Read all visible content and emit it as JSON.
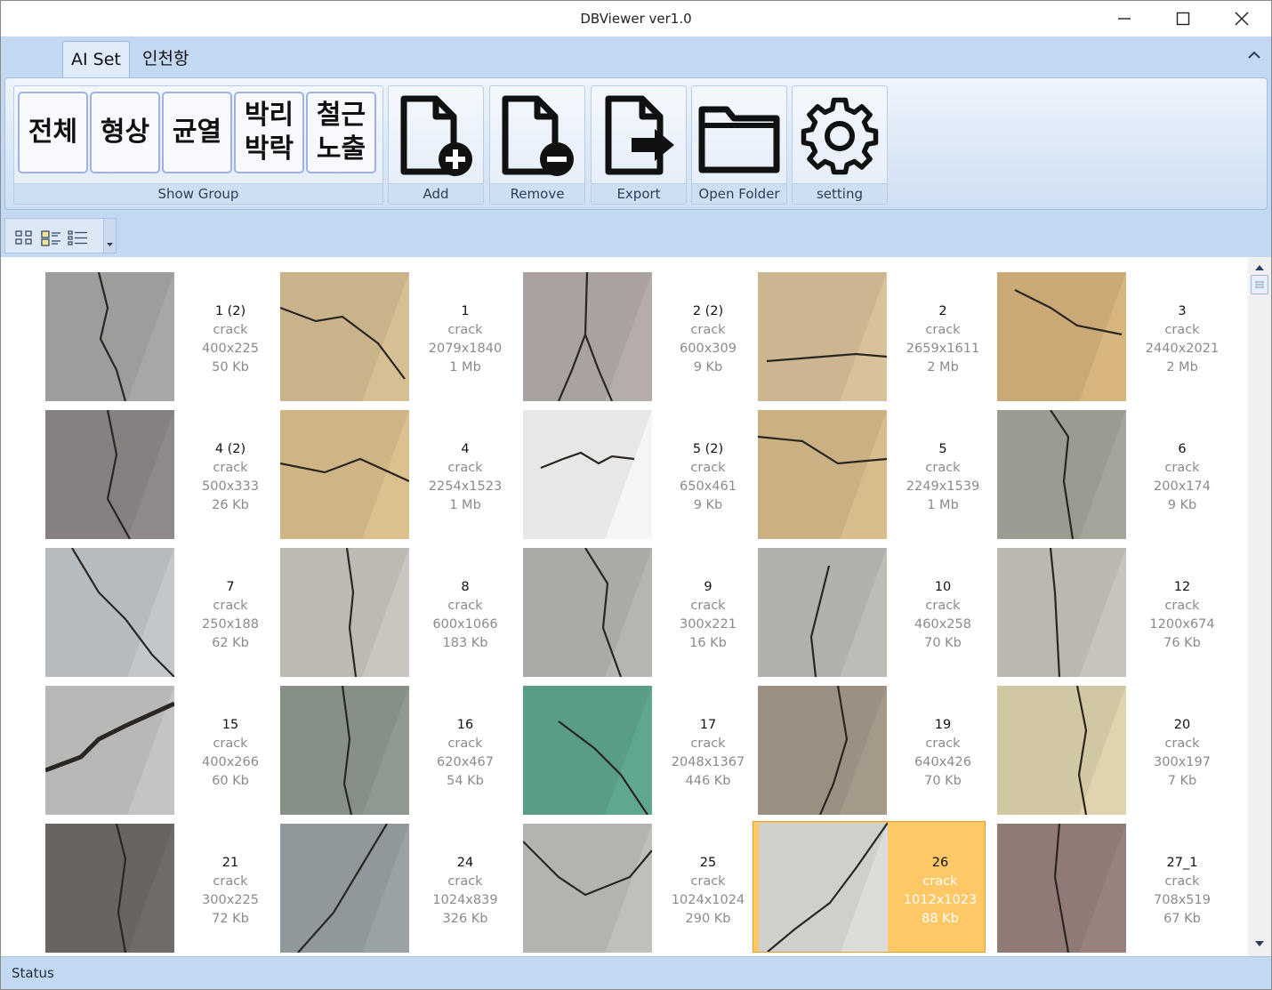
{
  "window": {
    "title": "DBViewer ver1.0"
  },
  "ribbon": {
    "tabs": [
      {
        "label": "AI Set",
        "active": true
      },
      {
        "label": "인천항",
        "active": false
      }
    ],
    "show_group": {
      "label": "Show Group",
      "buttons": [
        "전체",
        "형상",
        "균열",
        "박리\n박락",
        "철근\n노출"
      ]
    },
    "actions": [
      {
        "label": "Add",
        "icon": "add-file-icon"
      },
      {
        "label": "Remove",
        "icon": "remove-file-icon"
      },
      {
        "label": "Export",
        "icon": "export-file-icon"
      },
      {
        "label": "Open Folder",
        "icon": "folder-icon"
      },
      {
        "label": "setting",
        "icon": "gear-icon"
      }
    ]
  },
  "view_toolbar": {
    "icons": [
      "large-icons-view-icon",
      "details-view-icon",
      "list-view-icon"
    ]
  },
  "gallery": {
    "items": [
      {
        "name": "1 (2)",
        "type": "crack",
        "dims": "400x225",
        "size": "50 Kb",
        "tone": "#a7a7a5"
      },
      {
        "name": "1",
        "type": "crack",
        "dims": "2079x1840",
        "size": "1 Mb",
        "tone": "#d6bf93"
      },
      {
        "name": "2 (2)",
        "type": "crack",
        "dims": "600x309",
        "size": "9 Kb",
        "tone": "#b4adaa"
      },
      {
        "name": "2",
        "type": "crack",
        "dims": "2659x1611",
        "size": "2 Mb",
        "tone": "#d9c299"
      },
      {
        "name": "3",
        "type": "crack",
        "dims": "2440x2021",
        "size": "2 Mb",
        "tone": "#d8b47e"
      },
      {
        "name": "4 (2)",
        "type": "crack",
        "dims": "500x333",
        "size": "26 Kb",
        "tone": "#8f8a89"
      },
      {
        "name": "4",
        "type": "crack",
        "dims": "2254x1523",
        "size": "1 Mb",
        "tone": "#dcc08e"
      },
      {
        "name": "5 (2)",
        "type": "crack",
        "dims": "650x461",
        "size": "9 Kb",
        "tone": "#f6f6f6"
      },
      {
        "name": "5",
        "type": "crack",
        "dims": "2249x1539",
        "size": "1 Mb",
        "tone": "#d8bc8c"
      },
      {
        "name": "6",
        "type": "crack",
        "dims": "200x174",
        "size": "9 Kb",
        "tone": "#a3a69b"
      },
      {
        "name": "7",
        "type": "crack",
        "dims": "250x188",
        "size": "62 Kb",
        "tone": "#c2c7cc"
      },
      {
        "name": "8",
        "type": "crack",
        "dims": "600x1066",
        "size": "183 Kb",
        "tone": "#c9c6c0"
      },
      {
        "name": "9",
        "type": "crack",
        "dims": "300x221",
        "size": "16 Kb",
        "tone": "#b7b5b1"
      },
      {
        "name": "10",
        "type": "crack",
        "dims": "460x258",
        "size": "70 Kb",
        "tone": "#bdbcb7"
      },
      {
        "name": "12",
        "type": "crack",
        "dims": "1200x674",
        "size": "76 Kb",
        "tone": "#c8c3bb"
      },
      {
        "name": "15",
        "type": "crack",
        "dims": "400x266",
        "size": "60 Kb",
        "tone": "#c4c4c2"
      },
      {
        "name": "16",
        "type": "crack",
        "dims": "620x467",
        "size": "54 Kb",
        "tone": "#8f998f"
      },
      {
        "name": "17",
        "type": "crack",
        "dims": "2048x1367",
        "size": "446 Kb",
        "tone": "#5fa78f"
      },
      {
        "name": "19",
        "type": "crack",
        "dims": "640x426",
        "size": "70 Kb",
        "tone": "#a59a8a"
      },
      {
        "name": "20",
        "type": "crack",
        "dims": "300x197",
        "size": "7 Kb",
        "tone": "#dfd4ad"
      },
      {
        "name": "21",
        "type": "crack",
        "dims": "300x225",
        "size": "72 Kb",
        "tone": "#6f6c68"
      },
      {
        "name": "24",
        "type": "crack",
        "dims": "1024x839",
        "size": "326 Kb",
        "tone": "#9aa2a6"
      },
      {
        "name": "25",
        "type": "crack",
        "dims": "1024x1024",
        "size": "290 Kb",
        "tone": "#c1bfba"
      },
      {
        "name": "26",
        "type": "crack",
        "dims": "1012x1023",
        "size": "88 Kb",
        "tone": "#dcdcd8",
        "selected": true
      },
      {
        "name": "27_1",
        "type": "crack",
        "dims": "708x519",
        "size": "67 Kb",
        "tone": "#98827e"
      }
    ]
  },
  "status": {
    "text": "Status"
  }
}
